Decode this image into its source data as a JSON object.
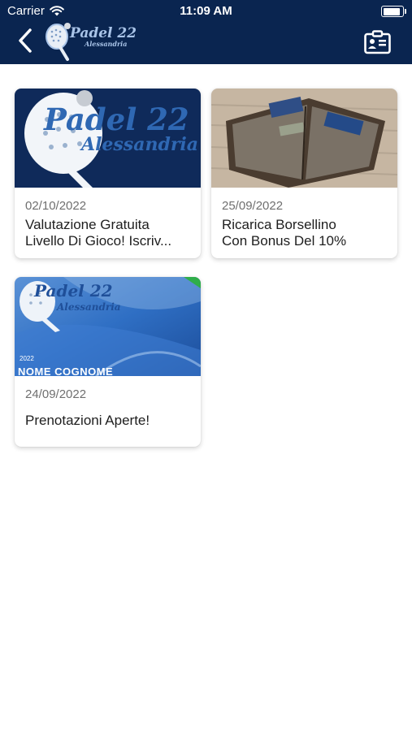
{
  "status_bar": {
    "carrier": "Carrier",
    "time": "11:09 AM",
    "battery_level": 1.0
  },
  "header": {
    "logo": {
      "title": "Padel 22",
      "subtitle": "Alessandria"
    },
    "background_color": "#0a2550"
  },
  "news": [
    {
      "date": "02/10/2022",
      "title_lines": [
        "Valutazione Gratuita",
        "Livello Di Gioco! Iscriv..."
      ],
      "image": {
        "type": "padel-logo",
        "title": "Padel 22",
        "subtitle": "Alessandria"
      }
    },
    {
      "date": "25/09/2022",
      "title_lines": [
        "Ricarica Borsellino",
        "Con Bonus Del 10%"
      ],
      "image": {
        "type": "wallet-photo"
      }
    },
    {
      "date": "24/09/2022",
      "title_lines": [
        "Prenotazioni Aperte!"
      ],
      "image": {
        "type": "membership-card",
        "title": "Padel 22",
        "subtitle": "Alessandria",
        "year": "2022",
        "name_label": "NOME COGNOME"
      }
    }
  ]
}
